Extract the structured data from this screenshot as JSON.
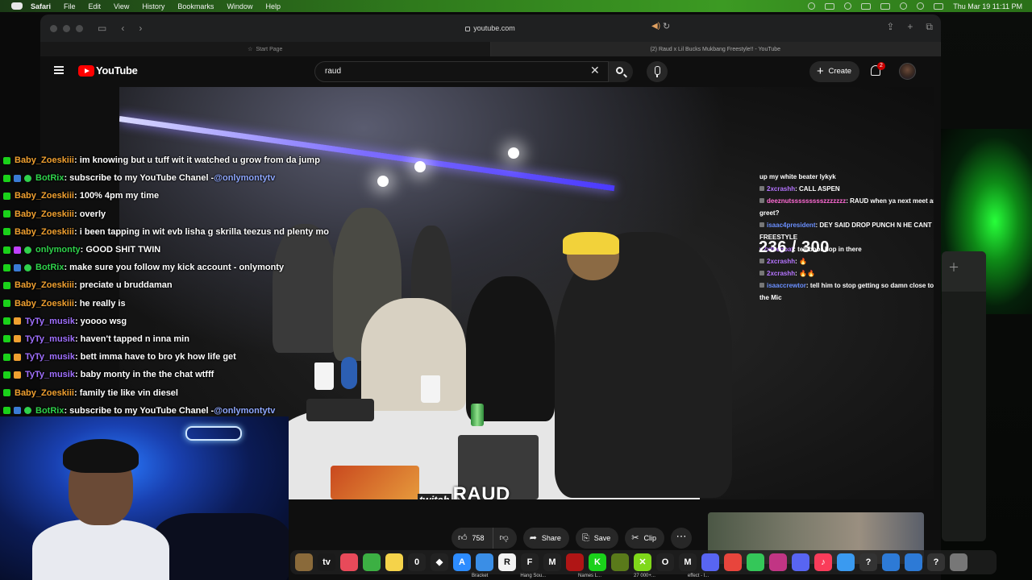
{
  "menubar": {
    "app": "Safari",
    "items": [
      "File",
      "Edit",
      "View",
      "History",
      "Bookmarks",
      "Window",
      "Help"
    ],
    "clock": "Thu Mar 19  11:11 PM"
  },
  "browser": {
    "url": "youtube.com",
    "tabs": [
      {
        "title": "Start Page",
        "active": false
      },
      {
        "title": "(2) Raud x Lil Bucks Mukbang Freestyle!! - YouTube",
        "active": true
      }
    ]
  },
  "youtube": {
    "logo_text": "YouTube",
    "search_value": "raud",
    "create_label": "Create",
    "notification_count": "2"
  },
  "video": {
    "counter": "236 / 300",
    "twitch_label": "twitch",
    "streamer_label": "RAUD",
    "chat": [
      {
        "user": "",
        "text": "up my white beater lykyk",
        "color": "#ffffff"
      },
      {
        "user": "2xcrashh",
        "text": "CALL ASPEN",
        "color": "#b574ff"
      },
      {
        "user": "deeznutssssssssszzzzzzz",
        "text": "RAUD when ya next meet and greet?",
        "color": "#ff6bd5"
      },
      {
        "user": "isaac4president",
        "text": "DEY SAID DROP PUNCH N HE CANT FREESTYLE",
        "color": "#6a8fff"
      },
      {
        "user": "v2xthegoat",
        "text": "tell boor hop in there",
        "color": "#b574ff"
      },
      {
        "user": "2xcrashh",
        "text": "🔥",
        "color": "#b574ff"
      },
      {
        "user": "2xcrashh",
        "text": "🔥🔥",
        "color": "#b574ff"
      },
      {
        "user": "isaaccrewtor",
        "text": "tell him to stop getting so damn close to the Mic",
        "color": "#6a8fff"
      }
    ]
  },
  "actions": {
    "likes": "758",
    "share": "Share",
    "save": "Save",
    "clip": "Clip",
    "more": "⋯"
  },
  "overlay_chat": [
    {
      "user": "Baby_Zoeskiii",
      "text": " : im knowing but u tuff wit it watched u grow from da jump",
      "color": "#f0a030",
      "mention": ""
    },
    {
      "user": "BotRix",
      "text": " : subscribe to my YouTube Chanel - ",
      "color": "#2fd24b",
      "mention": "@onlymontytv"
    },
    {
      "user": "Baby_Zoeskiii",
      "text": " : 100% 4pm my time",
      "color": "#f0a030",
      "mention": ""
    },
    {
      "user": "Baby_Zoeskiii",
      "text": " : overly",
      "color": "#f0a030",
      "mention": ""
    },
    {
      "user": "Baby_Zoeskiii",
      "text": " : i been tapping in wit evb lisha g skrilla teezus nd plenty mo",
      "color": "#f0a030",
      "mention": ""
    },
    {
      "user": "onlymonty",
      "text": " : GOOD SHIT TWIN",
      "color": "#2fd24b",
      "mention": ""
    },
    {
      "user": "BotRix",
      "text": " : make sure you follow my kick account - onlymonty",
      "color": "#2fd24b",
      "mention": ""
    },
    {
      "user": "Baby_Zoeskiii",
      "text": " : preciate u bruddaman",
      "color": "#f0a030",
      "mention": ""
    },
    {
      "user": "Baby_Zoeskiii",
      "text": " : he really is",
      "color": "#f0a030",
      "mention": ""
    },
    {
      "user": "TyTy_musik",
      "text": " : yoooo wsg",
      "color": "#a070ff",
      "mention": ""
    },
    {
      "user": "TyTy_musik",
      "text": " : haven't tapped n inna min",
      "color": "#a070ff",
      "mention": ""
    },
    {
      "user": "TyTy_musik",
      "text": " : bett imma have to bro yk how life get",
      "color": "#a070ff",
      "mention": ""
    },
    {
      "user": "TyTy_musik",
      "text": " : baby monty in the the chat wtfff",
      "color": "#a070ff",
      "mention": ""
    },
    {
      "user": "Baby_Zoeskiii",
      "text": " : family tie like vin diesel",
      "color": "#f0a030",
      "mention": ""
    },
    {
      "user": "BotRix",
      "text": " : subscribe to my YouTube Chanel - ",
      "color": "#2fd24b",
      "mention": "@onlymontytv"
    }
  ],
  "dock": {
    "items": [
      {
        "name": "finder-icon",
        "glyph": "",
        "bg": "#8a6a3a"
      },
      {
        "name": "apple-tv-icon",
        "glyph": "tv",
        "bg": "#1a1a1a"
      },
      {
        "name": "news-icon",
        "glyph": "",
        "bg": "#e84a5a"
      },
      {
        "name": "numbers-icon",
        "glyph": "",
        "bg": "#3cb043"
      },
      {
        "name": "notes-icon",
        "glyph": "",
        "bg": "#f5d34a"
      },
      {
        "name": "zero-app-icon",
        "glyph": "0",
        "bg": "#222"
      },
      {
        "name": "diamond-app-icon",
        "glyph": "◆",
        "bg": "#222"
      },
      {
        "name": "app-store-icon",
        "glyph": "A",
        "bg": "#2d8cff"
      },
      {
        "name": "preview-icon",
        "glyph": "",
        "bg": "#3a8ee6"
      },
      {
        "name": "r-app-icon",
        "glyph": "R",
        "bg": "#f2f2f2"
      },
      {
        "name": "f-app-icon",
        "glyph": "F",
        "bg": "#222"
      },
      {
        "name": "m-app-icon",
        "glyph": "M",
        "bg": "#222"
      },
      {
        "name": "record-app-icon",
        "glyph": "",
        "bg": "#b01515"
      },
      {
        "name": "kick-icon",
        "glyph": "K",
        "bg": "#1ad11a"
      },
      {
        "name": "banana-app-icon",
        "glyph": "",
        "bg": "#5a7a1a"
      },
      {
        "name": "x-app-icon",
        "glyph": "✕",
        "bg": "#7fd81a"
      },
      {
        "name": "o-app-icon",
        "glyph": "O",
        "bg": "#222"
      },
      {
        "name": "m2-app-icon",
        "glyph": "M",
        "bg": "#222"
      },
      {
        "name": "discord-bot-icon",
        "glyph": "",
        "bg": "#5865f2"
      },
      {
        "name": "chrome-icon",
        "glyph": "",
        "bg": "#e8453c"
      },
      {
        "name": "messages-icon",
        "glyph": "",
        "bg": "#34c759"
      },
      {
        "name": "instagram-icon",
        "glyph": "",
        "bg": "#c13584"
      },
      {
        "name": "discord-icon",
        "glyph": "",
        "bg": "#5865f2"
      },
      {
        "name": "music-icon",
        "glyph": "♪",
        "bg": "#fa3c5a"
      },
      {
        "name": "safari-icon",
        "glyph": "",
        "bg": "#3a9af0"
      },
      {
        "name": "help-icon",
        "glyph": "?",
        "bg": "#333"
      },
      {
        "name": "globe-icon",
        "glyph": "",
        "bg": "#2d7ad6"
      },
      {
        "name": "globe2-icon",
        "glyph": "",
        "bg": "#2d7ad6"
      },
      {
        "name": "help2-icon",
        "glyph": "?",
        "bg": "#333"
      },
      {
        "name": "trash-icon",
        "glyph": "",
        "bg": "#777"
      }
    ],
    "labels": [
      "Bracket",
      "Hang Sou...",
      "Names L...",
      "27 000+...",
      "effect - l..."
    ]
  }
}
